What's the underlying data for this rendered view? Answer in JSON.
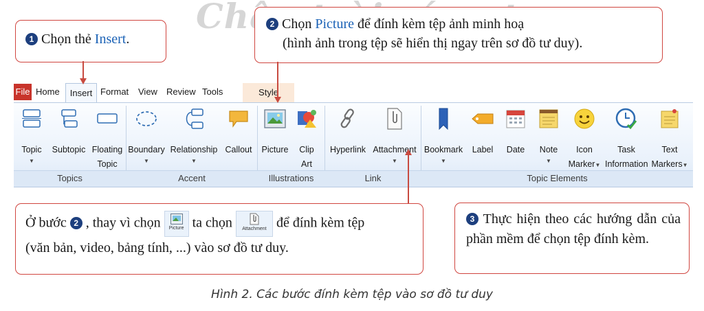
{
  "watermark": "Chân trời sáng tạo",
  "callout1": {
    "num": "1",
    "text": "Chọn thẻ ",
    "highlight": "Insert",
    "end": "."
  },
  "callout2": {
    "num": "2",
    "line1_a": "Chọn ",
    "highlight": "Picture",
    "line1_b": " để đính kèm tệp ảnh minh hoạ",
    "line2": "(hình ảnh trong tệp sẽ hiển thị ngay trên sơ đồ tư duy)."
  },
  "callout3": {
    "num": "3",
    "text": "Thực hiện theo các hướng dẫn của phần mềm để chọn tệp đính kèm."
  },
  "callout4": {
    "prefix": "Ở bước",
    "num": "2",
    "middle": ", thay vì chọn",
    "middle2": "ta chọn",
    "suffix": "để đính kèm tệp",
    "line2": "(văn bản, video, bảng tính, ...) vào sơ đồ tư duy.",
    "icon_picture": "Picture",
    "icon_attachment": "Attachment"
  },
  "tabs": [
    "File",
    "Home",
    "Insert",
    "Format",
    "View",
    "Review",
    "Tools",
    "Style"
  ],
  "groups": [
    "Topics",
    "Accent",
    "Illustrations",
    "Link",
    "Topic Elements"
  ],
  "buttons": {
    "topic": "Topic",
    "subtopic": "Subtopic",
    "floating1": "Floating",
    "floating2": "Topic",
    "boundary": "Boundary",
    "relationship": "Relationship",
    "callout": "Callout",
    "picture": "Picture",
    "clipart1": "Clip",
    "clipart2": "Art",
    "hyperlink": "Hyperlink",
    "attachment": "Attachment",
    "bookmark": "Bookmark",
    "label": "Label",
    "date": "Date",
    "note": "Note",
    "icon1": "Icon",
    "icon2": "Marker",
    "task1": "Task",
    "task2": "Information",
    "text1": "Text",
    "text2": "Markers"
  },
  "caption": "Hình 2. Các bước đính kèm tệp vào sơ đồ tư duy",
  "colors": {
    "callout_border": "#d0453f",
    "number_badge": "#1d3f7e",
    "highlight": "#1b62b6",
    "file_tab": "#c8342b"
  }
}
